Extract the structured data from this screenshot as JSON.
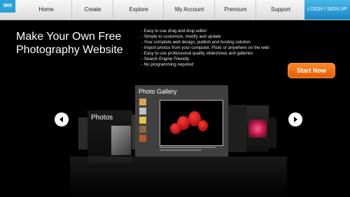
{
  "brand": {
    "logo_text": "WiX"
  },
  "nav": {
    "items": [
      "Home",
      "Create",
      "Explore",
      "My Account",
      "Premium",
      "Support"
    ],
    "login_label": "LOGIN / SIGN UP"
  },
  "hero": {
    "title": "Make Your Own Free Photography Website",
    "features": [
      "- Easy to use drag and drop editor",
      "- Simple to customize, modify and update",
      "- Your complete web design, publish and hosting solution",
      "- Import photos from your computer, Flickr or anywhere on the web",
      "- Easy to use professional quality slideshows and galleries",
      "- Search Engine Friendly",
      "- No programming required"
    ],
    "cta_label": "Start Now"
  },
  "carousel": {
    "left_card_title": "Photos",
    "main_card_title": "Photo Gallery"
  },
  "colors": {
    "accent_orange": "#ff7a1a",
    "accent_blue": "#1b86c6"
  }
}
